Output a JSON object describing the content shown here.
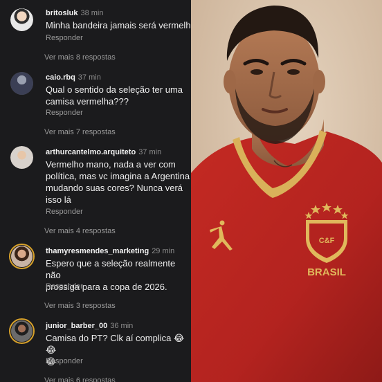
{
  "comments": [
    {
      "user": "britosluk",
      "time": "38 min",
      "text": "Minha bandeira jamais será vermelha",
      "reply_label": "Responder",
      "more_label": "Ver mais 8 respostas"
    },
    {
      "user": "caio.rbq",
      "time": "37 min",
      "text": "Qual o sentido da seleção ter uma\ncamisa vermelha???",
      "reply_label": "Responder",
      "more_label": "Ver mais 7 respostas"
    },
    {
      "user": "arthurcantelmo.arquiteto",
      "time": "37 min",
      "text": "Vermelho mano, nada a ver com\npolítica, mas vc imagina a Argentina\nmudando suas cores? Nunca verá\nisso lá",
      "reply_label": "Responder",
      "more_label": "Ver mais 4 respostas"
    },
    {
      "user": "thamyresmendes_marketing",
      "time": "29 min",
      "text": "Espero que a seleção realmente não\nprossiga para a copa de 2026.",
      "reply_label": "Responder",
      "more_label": "Ver mais 3 respostas"
    },
    {
      "user": "junior_barber_00",
      "time": "36 min",
      "text": "Camisa do PT?  Clk aí complica 😂😂\n😂",
      "reply_label": "Responder",
      "more_label": "Ver mais 6 respostas"
    }
  ],
  "photo": {
    "crest_text": "C&F",
    "brand_text": "BRASIL"
  },
  "colors": {
    "panel_bg": "#1b1b1d",
    "shirt_red": "#b3231f",
    "collar_gold": "#d9b15a",
    "photo_bg": "#d6c1a9"
  },
  "icons": {
    "brand_logo": "jumpman-logo",
    "crest": "cbf-crest"
  }
}
